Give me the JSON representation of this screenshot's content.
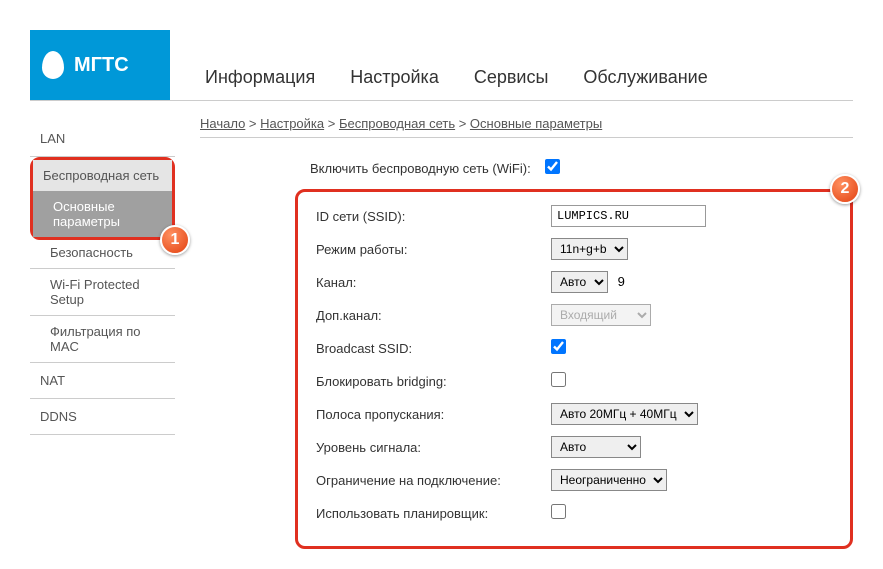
{
  "logo": "МГТС",
  "topnav": [
    "Информация",
    "Настройка",
    "Сервисы",
    "Обслуживание"
  ],
  "breadcrumb": [
    "Начало",
    "Настройка",
    "Беспроводная сеть",
    "Основные параметры"
  ],
  "sidebar": {
    "lan": "LAN",
    "wireless_group": "Беспроводная сеть",
    "basic": "Основные параметры",
    "security": "Безопасность",
    "wps": "Wi-Fi Protected Setup",
    "mac": "Фильтрация по MAC",
    "nat": "NAT",
    "ddns": "DDNS"
  },
  "form": {
    "enable_label": "Включить беспроводную сеть (WiFi):",
    "ssid_label": "ID сети (SSID):",
    "ssid_value": "LUMPICS.RU",
    "mode_label": "Режим работы:",
    "mode_value": "11n+g+b",
    "channel_label": "Канал:",
    "channel_value": "Авто",
    "channel_extra": "9",
    "ext_channel_label": "Доп.канал:",
    "ext_channel_value": "Входящий",
    "broadcast_label": "Broadcast SSID:",
    "bridging_label": "Блокировать bridging:",
    "bandwidth_label": "Полоса пропускания:",
    "bandwidth_value": "Авто 20МГц + 40МГц",
    "signal_label": "Уровень сигнала:",
    "signal_value": "Авто",
    "limit_label": "Ограничение на подключение:",
    "limit_value": "Неограниченно",
    "scheduler_label": "Использовать планировщик:"
  },
  "badges": {
    "one": "1",
    "two": "2"
  }
}
